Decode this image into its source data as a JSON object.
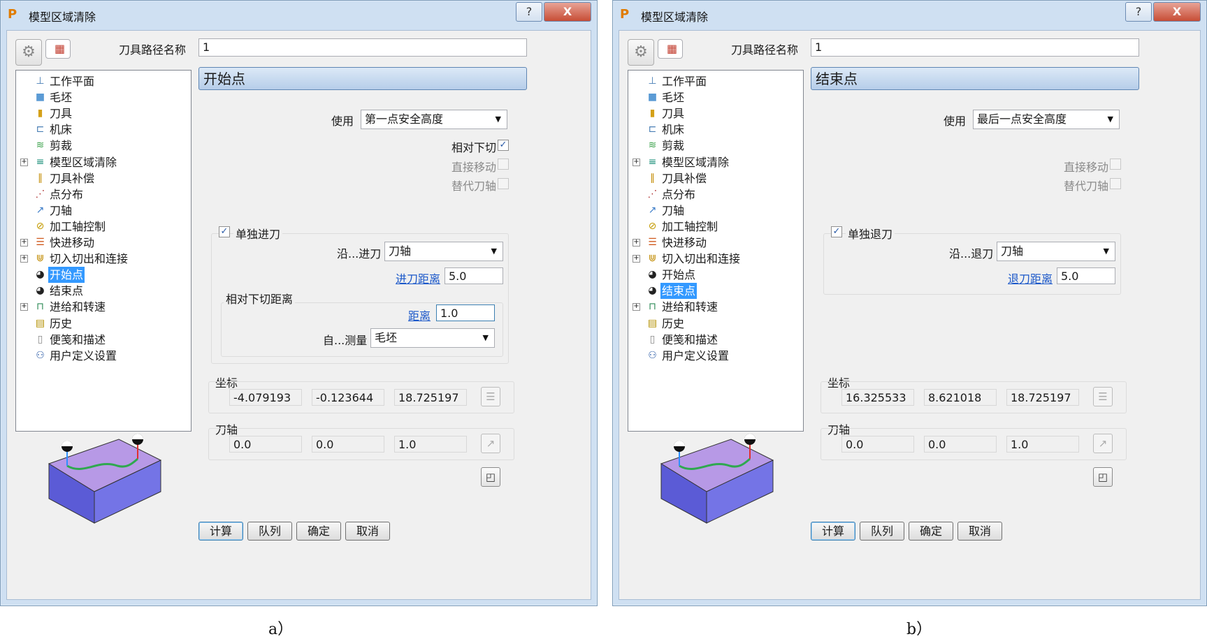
{
  "dialog_a": {
    "title": "模型区域清除",
    "title_logo": "P",
    "help_label": "?",
    "close_label": "X",
    "path_name_label": "刀具路径名称",
    "path_name_value": "1",
    "tree": [
      {
        "label": "工作平面",
        "icon": "workplane-icon",
        "glyph": "⊥",
        "color": "#4a7fb5",
        "expander": ""
      },
      {
        "label": "毛坯",
        "icon": "block-icon",
        "glyph": "■",
        "color": "#5b9bd5",
        "expander": ""
      },
      {
        "label": "刀具",
        "icon": "tool-icon",
        "glyph": "▮",
        "color": "#d4a017",
        "expander": ""
      },
      {
        "label": "机床",
        "icon": "machine-icon",
        "glyph": "⊏",
        "color": "#4a7fb5",
        "expander": ""
      },
      {
        "label": "剪裁",
        "icon": "limit-icon",
        "glyph": "≋",
        "color": "#3aa14a",
        "expander": ""
      },
      {
        "label": "模型区域清除",
        "icon": "area-clearance-icon",
        "glyph": "≡",
        "color": "#1b8f7a",
        "expander": "+"
      },
      {
        "label": "刀具补偿",
        "icon": "compensation-icon",
        "glyph": "∥",
        "color": "#c28a00",
        "expander": ""
      },
      {
        "label": "点分布",
        "icon": "point-distribution-icon",
        "glyph": "⋰",
        "color": "#b23a3a",
        "expander": ""
      },
      {
        "label": "刀轴",
        "icon": "tool-axis-icon",
        "glyph": "↗",
        "color": "#3a7bc8",
        "expander": ""
      },
      {
        "label": "加工轴控制",
        "icon": "axis-control-icon",
        "glyph": "⊘",
        "color": "#c49a00",
        "expander": ""
      },
      {
        "label": "快进移动",
        "icon": "rapid-move-icon",
        "glyph": "☰",
        "color": "#d05a1e",
        "expander": "+"
      },
      {
        "label": "切入切出和连接",
        "icon": "leads-links-icon",
        "glyph": "⋓",
        "color": "#c08a00",
        "expander": "+"
      },
      {
        "label": "开始点",
        "icon": "start-point-icon",
        "glyph": "◕",
        "color": "#222222",
        "expander": "",
        "active": true
      },
      {
        "label": "结束点",
        "icon": "end-point-icon",
        "glyph": "◕",
        "color": "#222222",
        "expander": ""
      },
      {
        "label": "进给和转速",
        "icon": "feeds-speeds-icon",
        "glyph": "⊓",
        "color": "#2e8b57",
        "expander": "+"
      },
      {
        "label": "历史",
        "icon": "history-icon",
        "glyph": "▤",
        "color": "#b38f00",
        "expander": ""
      },
      {
        "label": "便笺和描述",
        "icon": "notes-icon",
        "glyph": "▯",
        "color": "#888888",
        "expander": ""
      },
      {
        "label": "用户定义设置",
        "icon": "user-settings-icon",
        "glyph": "⚇",
        "color": "#2a5aa6",
        "expander": ""
      }
    ],
    "section_header": "开始点",
    "use_label": "使用",
    "use_value": "第一点安全高度",
    "relative_plunge_label": "相对下切",
    "relative_plunge_checked": "✓",
    "direct_move_label": "直接移动",
    "substitute_axis_label": "替代刀轴",
    "separate_move_label": "单独进刀",
    "separate_move_checked": "✓",
    "along_label": "沿...进刀",
    "along_value": "刀轴",
    "move_distance_label": "进刀距离",
    "move_distance_value": "5.0",
    "plunge_group_label": "相对下切距离",
    "distance_label": "距离",
    "distance_value": "1.0",
    "measure_label": "自...测量",
    "measure_value": "毛坯",
    "coords_label": "坐标",
    "coords": [
      "-4.079193",
      "-0.123644",
      "18.725197"
    ],
    "axis_label": "刀轴",
    "axis": [
      "0.0",
      "0.0",
      "1.0"
    ],
    "buttons": {
      "calculate": "计算",
      "queue": "队列",
      "ok": "确定",
      "cancel": "取消"
    },
    "caption": "a）"
  },
  "dialog_b": {
    "title": "模型区域清除",
    "title_logo": "P",
    "help_label": "?",
    "close_label": "X",
    "path_name_label": "刀具路径名称",
    "path_name_value": "1",
    "tree": [
      {
        "label": "工作平面",
        "icon": "workplane-icon",
        "glyph": "⊥",
        "color": "#4a7fb5",
        "expander": ""
      },
      {
        "label": "毛坯",
        "icon": "block-icon",
        "glyph": "■",
        "color": "#5b9bd5",
        "expander": ""
      },
      {
        "label": "刀具",
        "icon": "tool-icon",
        "glyph": "▮",
        "color": "#d4a017",
        "expander": ""
      },
      {
        "label": "机床",
        "icon": "machine-icon",
        "glyph": "⊏",
        "color": "#4a7fb5",
        "expander": ""
      },
      {
        "label": "剪裁",
        "icon": "limit-icon",
        "glyph": "≋",
        "color": "#3aa14a",
        "expander": ""
      },
      {
        "label": "模型区域清除",
        "icon": "area-clearance-icon",
        "glyph": "≡",
        "color": "#1b8f7a",
        "expander": "+"
      },
      {
        "label": "刀具补偿",
        "icon": "compensation-icon",
        "glyph": "∥",
        "color": "#c28a00",
        "expander": ""
      },
      {
        "label": "点分布",
        "icon": "point-distribution-icon",
        "glyph": "⋰",
        "color": "#b23a3a",
        "expander": ""
      },
      {
        "label": "刀轴",
        "icon": "tool-axis-icon",
        "glyph": "↗",
        "color": "#3a7bc8",
        "expander": ""
      },
      {
        "label": "加工轴控制",
        "icon": "axis-control-icon",
        "glyph": "⊘",
        "color": "#c49a00",
        "expander": ""
      },
      {
        "label": "快进移动",
        "icon": "rapid-move-icon",
        "glyph": "☰",
        "color": "#d05a1e",
        "expander": "+"
      },
      {
        "label": "切入切出和连接",
        "icon": "leads-links-icon",
        "glyph": "⋓",
        "color": "#c08a00",
        "expander": "+"
      },
      {
        "label": "开始点",
        "icon": "start-point-icon",
        "glyph": "◕",
        "color": "#222222",
        "expander": ""
      },
      {
        "label": "结束点",
        "icon": "end-point-icon",
        "glyph": "◕",
        "color": "#222222",
        "expander": "",
        "active": true
      },
      {
        "label": "进给和转速",
        "icon": "feeds-speeds-icon",
        "glyph": "⊓",
        "color": "#2e8b57",
        "expander": "+"
      },
      {
        "label": "历史",
        "icon": "history-icon",
        "glyph": "▤",
        "color": "#b38f00",
        "expander": ""
      },
      {
        "label": "便笺和描述",
        "icon": "notes-icon",
        "glyph": "▯",
        "color": "#888888",
        "expander": ""
      },
      {
        "label": "用户定义设置",
        "icon": "user-settings-icon",
        "glyph": "⚇",
        "color": "#2a5aa6",
        "expander": ""
      }
    ],
    "section_header": "结束点",
    "use_label": "使用",
    "use_value": "最后一点安全高度",
    "direct_move_label": "直接移动",
    "substitute_axis_label": "替代刀轴",
    "separate_move_label": "单独退刀",
    "separate_move_checked": "✓",
    "along_label": "沿...退刀",
    "along_value": "刀轴",
    "move_distance_label": "退刀距离",
    "move_distance_value": "5.0",
    "coords_label": "坐标",
    "coords": [
      "16.325533",
      "8.621018",
      "18.725197"
    ],
    "axis_label": "刀轴",
    "axis": [
      "0.0",
      "0.0",
      "1.0"
    ],
    "buttons": {
      "calculate": "计算",
      "queue": "队列",
      "ok": "确定",
      "cancel": "取消"
    },
    "caption": "b）"
  }
}
